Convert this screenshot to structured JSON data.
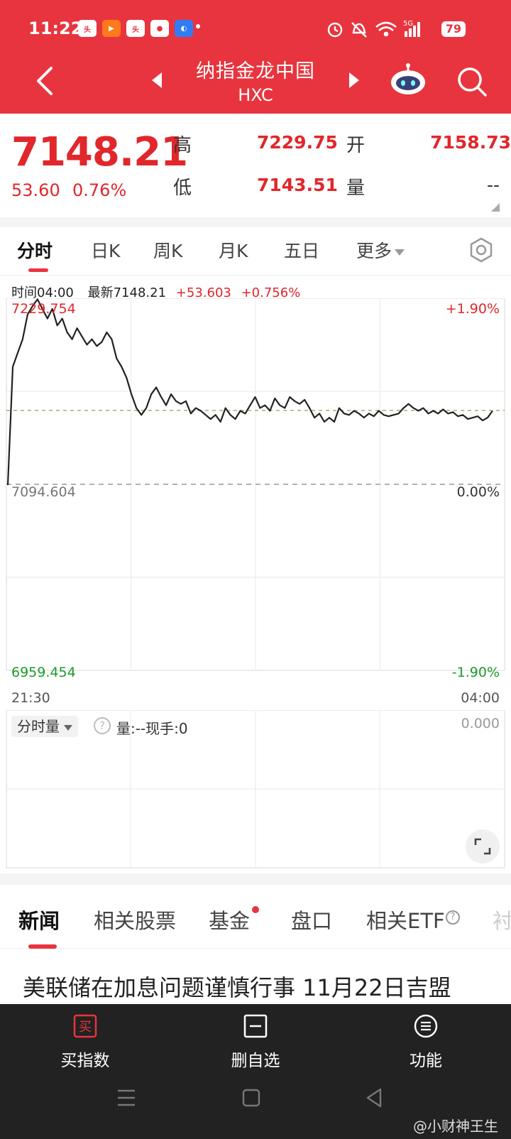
{
  "status_bar": {
    "time": "11:22",
    "battery": "79",
    "icons": [
      "toutiao-icon",
      "video-icon",
      "toutiao-icon",
      "map-pin-icon",
      "browser-icon",
      "alarm-icon",
      "mute-icon",
      "wifi-icon",
      "5g-signal-icon"
    ]
  },
  "header": {
    "title": "纳指金龙中国",
    "code": "HXC"
  },
  "quote": {
    "price": "7148.21",
    "change": "53.60",
    "change_pct": "0.76%",
    "high_label": "高",
    "high": "7229.75",
    "open_label": "开",
    "open": "7158.73",
    "low_label": "低",
    "low": "7143.51",
    "volume_label": "量",
    "volume": "--"
  },
  "chart_tabs": [
    {
      "label": "分时",
      "active": true
    },
    {
      "label": "日K"
    },
    {
      "label": "周K"
    },
    {
      "label": "月K"
    },
    {
      "label": "五日"
    },
    {
      "label": "更多"
    }
  ],
  "chart_info": {
    "time": "时间04:00",
    "latest": "最新7148.21",
    "change": "+53.603",
    "change_pct": "+0.756%"
  },
  "chart_data": {
    "type": "line",
    "title": "",
    "xlabel": "",
    "ylabel": "",
    "x_start_label": "21:30",
    "x_end_label": "04:00",
    "ylim": [
      6959.454,
      7229.754
    ],
    "y_top_label": "7229.754",
    "y_mid_label": "7094.604",
    "y_bottom_label": "6959.454",
    "pct_top_label": "+1.90%",
    "pct_mid_label": "0.00%",
    "pct_bottom_label": "-1.90%",
    "prev_close": 7094.604,
    "latest": 7148.21,
    "series": [
      {
        "values": [
          7094,
          7180,
          7190,
          7200,
          7218,
          7224,
          7229,
          7222,
          7215,
          7222,
          7210,
          7215,
          7205,
          7200,
          7208,
          7202,
          7196,
          7200,
          7195,
          7198,
          7205,
          7200,
          7186,
          7180,
          7172,
          7160,
          7150,
          7145,
          7150,
          7160,
          7165,
          7158,
          7152,
          7160,
          7155,
          7153,
          7155,
          7146,
          7150,
          7148,
          7145,
          7142,
          7145,
          7140,
          7150,
          7145,
          7142,
          7148,
          7146,
          7152,
          7158,
          7150,
          7152,
          7148,
          7157,
          7152,
          7150,
          7158,
          7155,
          7153,
          7156,
          7150,
          7143,
          7146,
          7140,
          7143,
          7140,
          7150,
          7146,
          7145,
          7148,
          7146,
          7143,
          7146,
          7144,
          7148,
          7145,
          7144,
          7145,
          7146,
          7150,
          7153,
          7150,
          7148,
          7150,
          7146,
          7148,
          7146,
          7149,
          7146,
          7147,
          7144,
          7145,
          7142,
          7143,
          7144,
          7141,
          7143,
          7148
        ]
      }
    ]
  },
  "volume_panel": {
    "selector": "分时量",
    "info": "量:--现手:0",
    "value": "0.000"
  },
  "news_tabs": [
    {
      "label": "新闻",
      "active": true
    },
    {
      "label": "相关股票"
    },
    {
      "label": "基金"
    },
    {
      "label": "盘口"
    },
    {
      "label": "相关ETF"
    },
    {
      "label": "衬"
    }
  ],
  "headline": "美联储在加息问题谨慎行事 11月22日吉盟",
  "bottom_bar": [
    {
      "label": "买指数",
      "icon": "buy-icon",
      "icon_text": "买"
    },
    {
      "label": "删自选",
      "icon": "remove-watchlist-icon"
    },
    {
      "label": "功能",
      "icon": "menu-icon"
    }
  ],
  "watermark": "@小财神王生",
  "colors": {
    "brand_red": "#e8343e",
    "up_red": "#e1272b",
    "down_green": "#1b9a2a",
    "line": "#222222"
  }
}
